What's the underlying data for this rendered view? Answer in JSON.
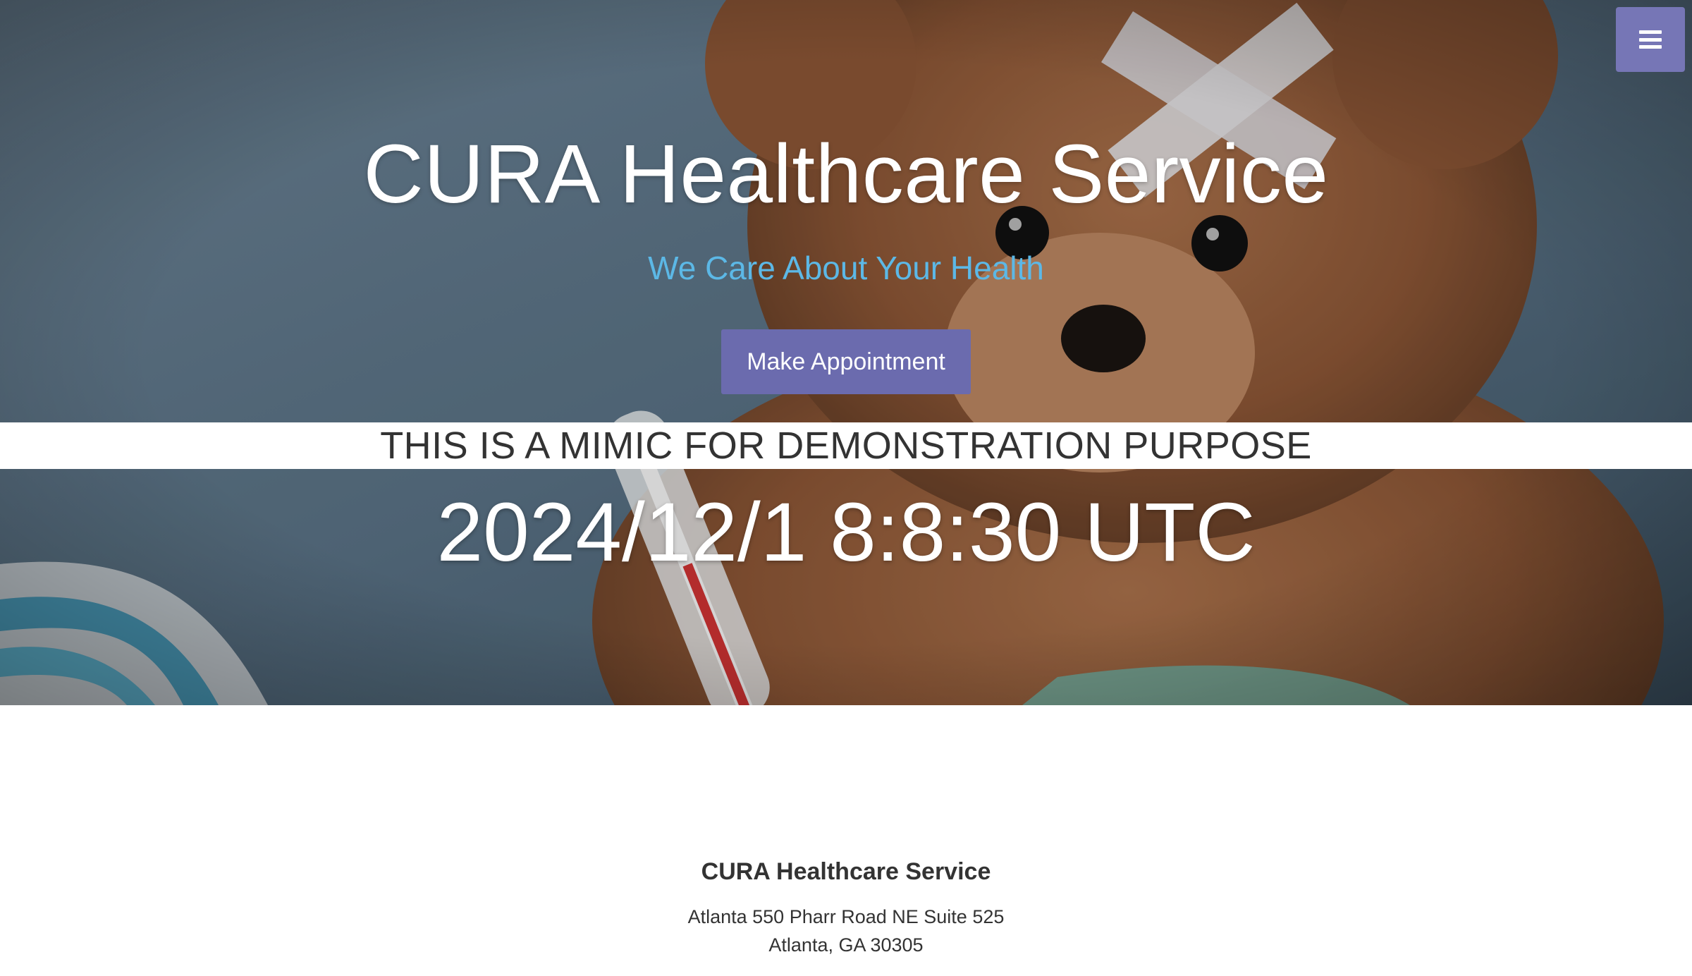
{
  "hero": {
    "title": "CURA Healthcare Service",
    "subtitle": "We Care About Your Health",
    "appointment_button_label": "Make Appointment",
    "notice": "THIS IS A MIMIC FOR DEMONSTRATION PURPOSE",
    "timestamp": "2024/12/1 8:8:30 UTC",
    "background_image": "teddy-bear-with-bandage-and-thermometer"
  },
  "menu": {
    "icon": "hamburger-menu-icon"
  },
  "footer": {
    "title": "CURA Healthcare Service",
    "address_line1": "Atlanta 550 Pharr Road NE Suite 525",
    "address_line2": "Atlanta, GA 30305"
  },
  "colors": {
    "accent": "#6b6bae",
    "menu_button": "#7676b6",
    "subtitle": "#5cb8e6",
    "text_dark": "#333333"
  }
}
